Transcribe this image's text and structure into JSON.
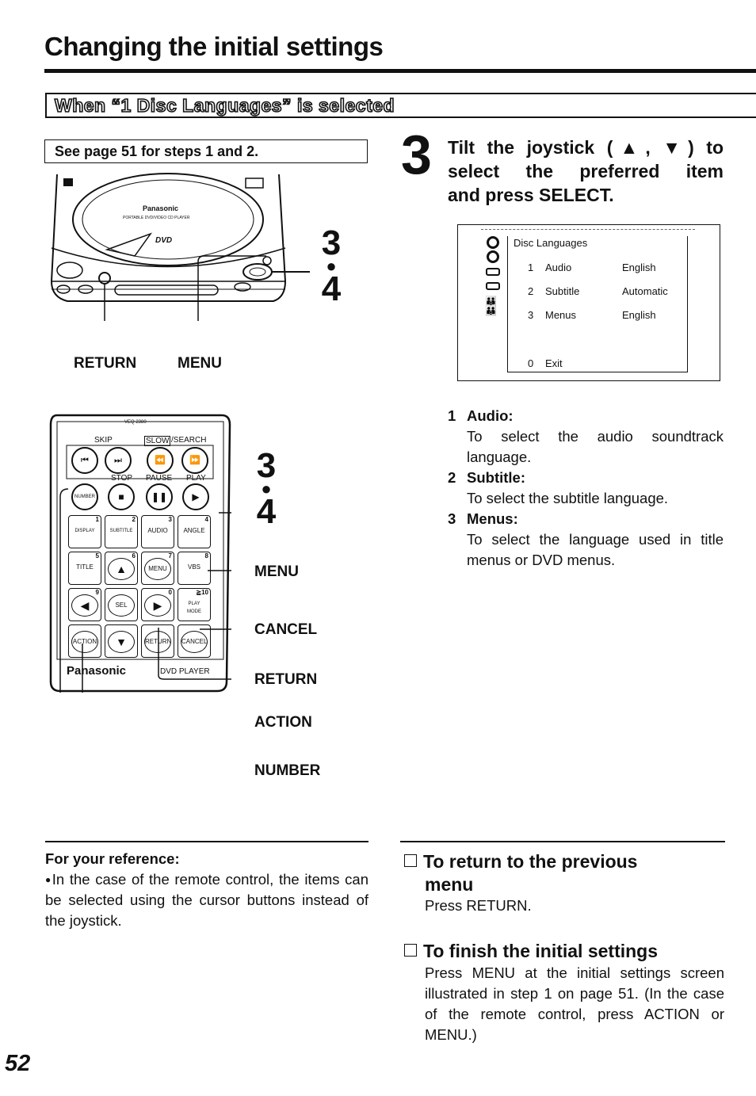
{
  "page": {
    "title": "Changing the initial settings",
    "section_heading": "When “1 Disc Languages” is selected",
    "page_number": "52"
  },
  "note_box": {
    "text": "See page 51 for steps 1 and 2."
  },
  "player_illustration": {
    "brand": "Panasonic",
    "model_line": "PORTABLE DVD/VIDEO CD PLAYER",
    "logo": "DVD",
    "step_marker_top": "3",
    "step_marker_bottom": "4",
    "labels": {
      "return": "RETURN",
      "menu": "MENU"
    }
  },
  "remote_illustration": {
    "model": "VEQ 2380",
    "brand": "Panasonic",
    "footer_label": "DVD PLAYER",
    "group_labels": {
      "skip": "SKIP",
      "slow": "SLOW",
      "search": "/SEARCH",
      "stop": "STOP",
      "pause": "PAUSE",
      "play": "PLAY"
    },
    "buttons": [
      {
        "label": "NUMBER"
      },
      {
        "label": "DISPLAY",
        "num": "1"
      },
      {
        "label": "SUBTITLE",
        "num": "2"
      },
      {
        "label": "AUDIO",
        "num": "3"
      },
      {
        "label": "ANGLE",
        "num": "4"
      },
      {
        "label": "TITLE",
        "num": "5"
      },
      {
        "label": "▲",
        "num": "6"
      },
      {
        "label": "MENU",
        "num": "7"
      },
      {
        "label": "VBS",
        "num": "8"
      },
      {
        "label": "◀",
        "num": "9"
      },
      {
        "label": "SEL"
      },
      {
        "label": "▶",
        "num": "0"
      },
      {
        "label": "PLAY MODE",
        "num": "≧10"
      },
      {
        "label": "ACTION"
      },
      {
        "label": "▼"
      },
      {
        "label": "RETURN"
      },
      {
        "label": "CANCEL"
      }
    ],
    "step_marker_top": "3",
    "step_marker_bottom": "4",
    "callouts": [
      "MENU",
      "CANCEL",
      "RETURN",
      "ACTION",
      "NUMBER"
    ]
  },
  "step3": {
    "number": "3",
    "lines": [
      "Tilt the joystick (▲, ▼) to",
      "select the preferred item",
      "and press SELECT."
    ]
  },
  "osd": {
    "title": "Disc Languages",
    "rows": [
      {
        "num": "1",
        "label": "Audio",
        "value": "English"
      },
      {
        "num": "2",
        "label": "Subtitle",
        "value": "Automatic"
      },
      {
        "num": "3",
        "label": "Menus",
        "value": "English"
      }
    ],
    "exit": {
      "num": "0",
      "label": "Exit"
    },
    "side_icons": [
      "disc-icon",
      "disc-icon",
      "tape-icon",
      "tape-icon",
      "people-icon",
      "people-icon"
    ]
  },
  "items": [
    {
      "num": "1",
      "name": "Audio:",
      "desc": "To select the audio soundtrack language."
    },
    {
      "num": "2",
      "name": "Subtitle:",
      "desc": "To select the subtitle language."
    },
    {
      "num": "3",
      "name": "Menus:",
      "desc": "To select the language used in title menus or DVD menus."
    }
  ],
  "reference": {
    "title": "For your reference:",
    "bullet": "●",
    "text": "In the case of the remote control, the items can be selected using the cursor buttons instead of the joystick."
  },
  "return_section": {
    "heading_line1": "To return to the previous",
    "heading_line2": "menu",
    "body": "Press RETURN."
  },
  "finish_section": {
    "heading": "To finish the initial settings",
    "body": "Press MENU at the initial settings screen illustrated in step 1 on page 51. (In the case of the remote control, press ACTION or MENU.)"
  }
}
